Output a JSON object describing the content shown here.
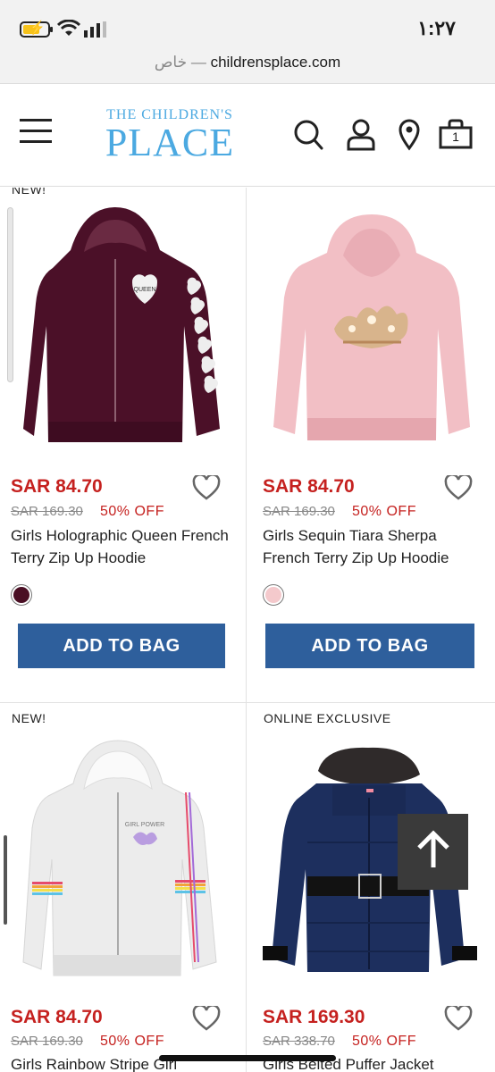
{
  "status": {
    "time": "١:٢٧"
  },
  "browser": {
    "private_label": "خاص —",
    "domain": "childrensplace.com"
  },
  "site": {
    "logo_line1": "THE CHILDREN'S",
    "logo_line2": "PLACE",
    "bag_count": "1"
  },
  "colors": {
    "sale_red": "#c5211f",
    "button_blue": "#2e5f9c",
    "logo_blue": "#4ba9e1"
  },
  "top_partial_badge": "NEW!",
  "products": [
    {
      "price": "SAR 84.70",
      "was_price": "SAR 169.30",
      "discount": "50% OFF",
      "name": "Girls Holographic Queen French Terry Zip Up Hoodie",
      "swatch_color": "#4a0f24",
      "button": "ADD TO BAG",
      "image_desc": "burgundy zip hoodie"
    },
    {
      "price": "SAR 84.70",
      "was_price": "SAR 169.30",
      "discount": "50% OFF",
      "name": "Girls Sequin Tiara Sherpa French Terry Zip Up Hoodie",
      "swatch_color": "#f4c9cc",
      "button": "ADD TO BAG",
      "image_desc": "pink hoodie back"
    },
    {
      "badge": "NEW!",
      "price": "SAR 84.70",
      "was_price": "SAR 169.30",
      "discount": "50% OFF",
      "name": "Girls Rainbow Stripe Girl",
      "image_desc": "grey rainbow stripe hoodie"
    },
    {
      "badge": "ONLINE EXCLUSIVE",
      "price": "SAR 169.30",
      "was_price": "SAR 338.70",
      "discount": "50% OFF",
      "name": "Girls Belted Puffer Jacket",
      "image_desc": "navy belted puffer jacket"
    }
  ]
}
